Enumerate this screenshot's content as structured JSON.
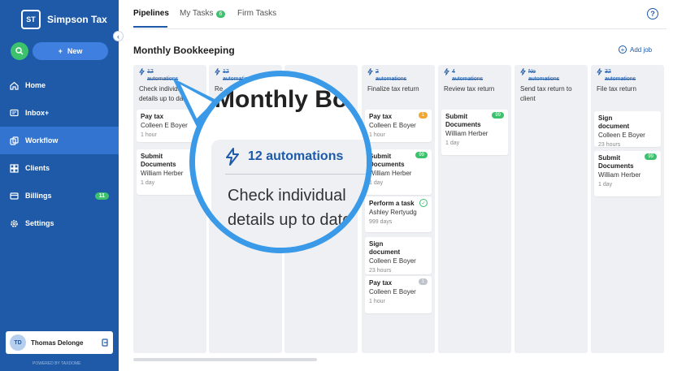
{
  "brand": {
    "initials": "ST",
    "name": "Simpson Tax"
  },
  "sidebar": {
    "new_label": "New",
    "items": [
      {
        "label": "Home",
        "icon": "home-icon"
      },
      {
        "label": "Inbox+",
        "icon": "inbox-icon"
      },
      {
        "label": "Workflow",
        "icon": "workflow-icon",
        "active": true
      },
      {
        "label": "Clients",
        "icon": "clients-icon"
      },
      {
        "label": "Billings",
        "icon": "billing-icon",
        "badge": "11"
      },
      {
        "label": "Settings",
        "icon": "gear-icon"
      }
    ],
    "user": {
      "initials": "TD",
      "name": "Thomas Delonge"
    },
    "powered_by": "POWERED BY TAXDOME"
  },
  "tabs": {
    "pipelines": "Pipelines",
    "my_tasks": "My Tasks",
    "my_tasks_badge": "6",
    "firm_tasks": "Firm Tasks"
  },
  "page": {
    "title": "Monthly Bookkeeping",
    "add_job": "Add job"
  },
  "columns": [
    {
      "automations": "12",
      "automations_label": "automations",
      "title": "Check individual details up to date",
      "cards": [
        {
          "title": "Pay tax",
          "user": "Colleen E Boyer",
          "time": "1 hour",
          "badge": ""
        },
        {
          "title": "Submit Documents",
          "user": "William Herber",
          "time": "1 day",
          "badge": ""
        }
      ]
    },
    {
      "automations": "12",
      "automations_label": "automations",
      "title": "Re",
      "cards": []
    },
    {
      "automations": "",
      "automations_label": "",
      "title": "",
      "cards": []
    },
    {
      "automations": "2",
      "automations_label": "automations",
      "title": "Finalize tax return",
      "cards": [
        {
          "title": "Pay tax",
          "user": "Colleen E Boyer",
          "time": "1 hour",
          "badge": "1",
          "badge_color": "#f0a830"
        },
        {
          "title": "Submit Documents",
          "user": "William Herber",
          "time": "1 day",
          "badge": "99",
          "badge_color": "#3cc16c"
        },
        {
          "title": "Perform a task",
          "user": "Ashley Rertyudg",
          "time": "999 days",
          "badge": "✓",
          "badge_color": "check"
        },
        {
          "title": "Sign document",
          "user": "Colleen E Boyer",
          "time": "23 hours",
          "badge": ""
        },
        {
          "title": "Pay tax",
          "user": "Colleen E Boyer",
          "time": "1 hour",
          "badge": "1",
          "badge_color": "#bfc4cc"
        }
      ]
    },
    {
      "automations": "4",
      "automations_label": "automations",
      "title": "Review tax return",
      "cards": [
        {
          "title": "Submit Documents",
          "user": "William Herber",
          "time": "1 day",
          "badge": "99",
          "badge_color": "#3cc16c"
        }
      ]
    },
    {
      "automations": "No",
      "automations_label": "automations",
      "title": "Send tax return to client",
      "cards": []
    },
    {
      "automations": "32",
      "automations_label": "automations",
      "title": "File tax return",
      "cards": [
        {
          "title": "Sign document",
          "user": "Colleen E Boyer",
          "time": "23 hours",
          "badge": ""
        },
        {
          "title": "Submit Documents",
          "user": "William Herber",
          "time": "1 day",
          "badge": "99",
          "badge_color": "#3cc16c"
        }
      ]
    }
  ],
  "magnifier": {
    "title": "Monthly Boo",
    "automations": "12 automations",
    "text_line1": "Check individual",
    "text_line2": "details up to date"
  }
}
